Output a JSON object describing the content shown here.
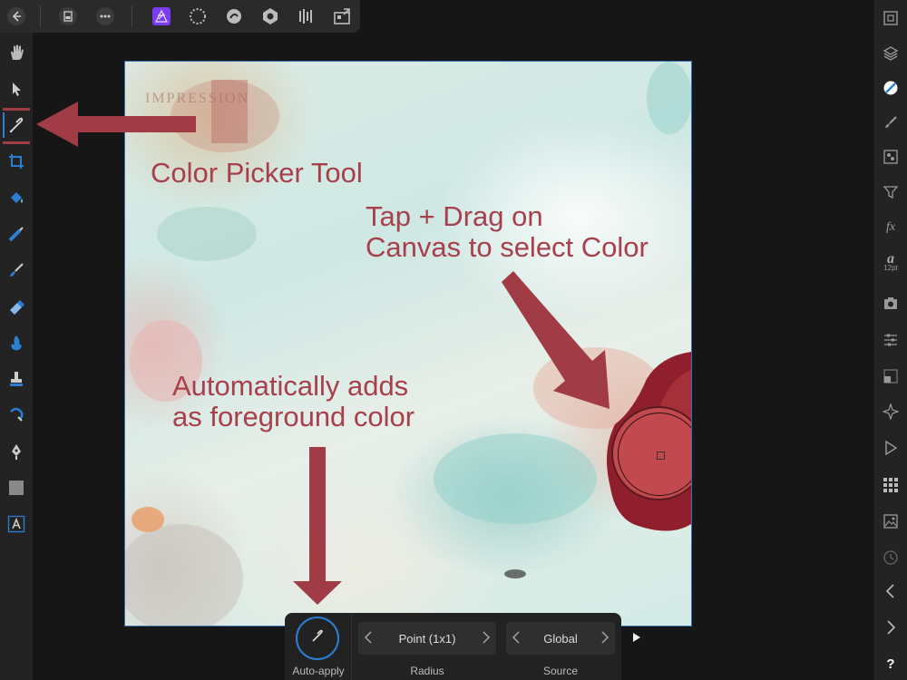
{
  "top_toolbar": {
    "icons": [
      "back-icon",
      "document-icon",
      "more-icon",
      "photo-persona-icon",
      "selection-persona-icon",
      "liquify-persona-icon",
      "develop-persona-icon",
      "tone-mapping-persona-icon",
      "export-persona-icon"
    ]
  },
  "left_tools": {
    "items": [
      "view-tool",
      "move-tool",
      "color-picker-tool",
      "crop-tool",
      "flood-fill-tool",
      "gradient-tool",
      "paint-brush-tool",
      "erase-brush-tool",
      "dodge-burn-tool",
      "clone-tool",
      "healing-tool",
      "pen-tool",
      "shape-tool",
      "artistic-text-tool"
    ],
    "selected": "color-picker-tool"
  },
  "right_studio": {
    "items": [
      "navigator-icon",
      "layers-icon",
      "color-icon",
      "brushes-icon",
      "channels-icon",
      "filters-icon",
      "fx-icon",
      "text-icon",
      "snapshots-icon",
      "adjustments-icon",
      "transform-icon",
      "navigator-cross-icon",
      "play-icon",
      "swatches-icon",
      "image-icon",
      "history-icon",
      "chevron-left-icon",
      "chevron-right-icon",
      "help-icon"
    ],
    "text_icon_label": "a",
    "text_icon_size": "12pt",
    "help_label": "?",
    "fx_label": "fx"
  },
  "canvas": {
    "background_text": "IMPRESSION"
  },
  "annotations": {
    "color_picker_tool": "Color Picker Tool",
    "tap_drag_line1": "Tap + Drag on",
    "tap_drag_line2": "Canvas to select Color",
    "auto_adds_line1": "Automatically adds",
    "auto_adds_line2": "as foreground color"
  },
  "colors": {
    "annotation": "#a8404c",
    "arrow": "#a13c46",
    "picked_color": "#c24a4e",
    "accent_blue": "#2a7fd4"
  },
  "context_toolbar": {
    "auto_apply_label": "Auto-apply",
    "radius": {
      "value": "Point (1x1)",
      "label": "Radius"
    },
    "source": {
      "value": "Global",
      "label": "Source"
    }
  }
}
